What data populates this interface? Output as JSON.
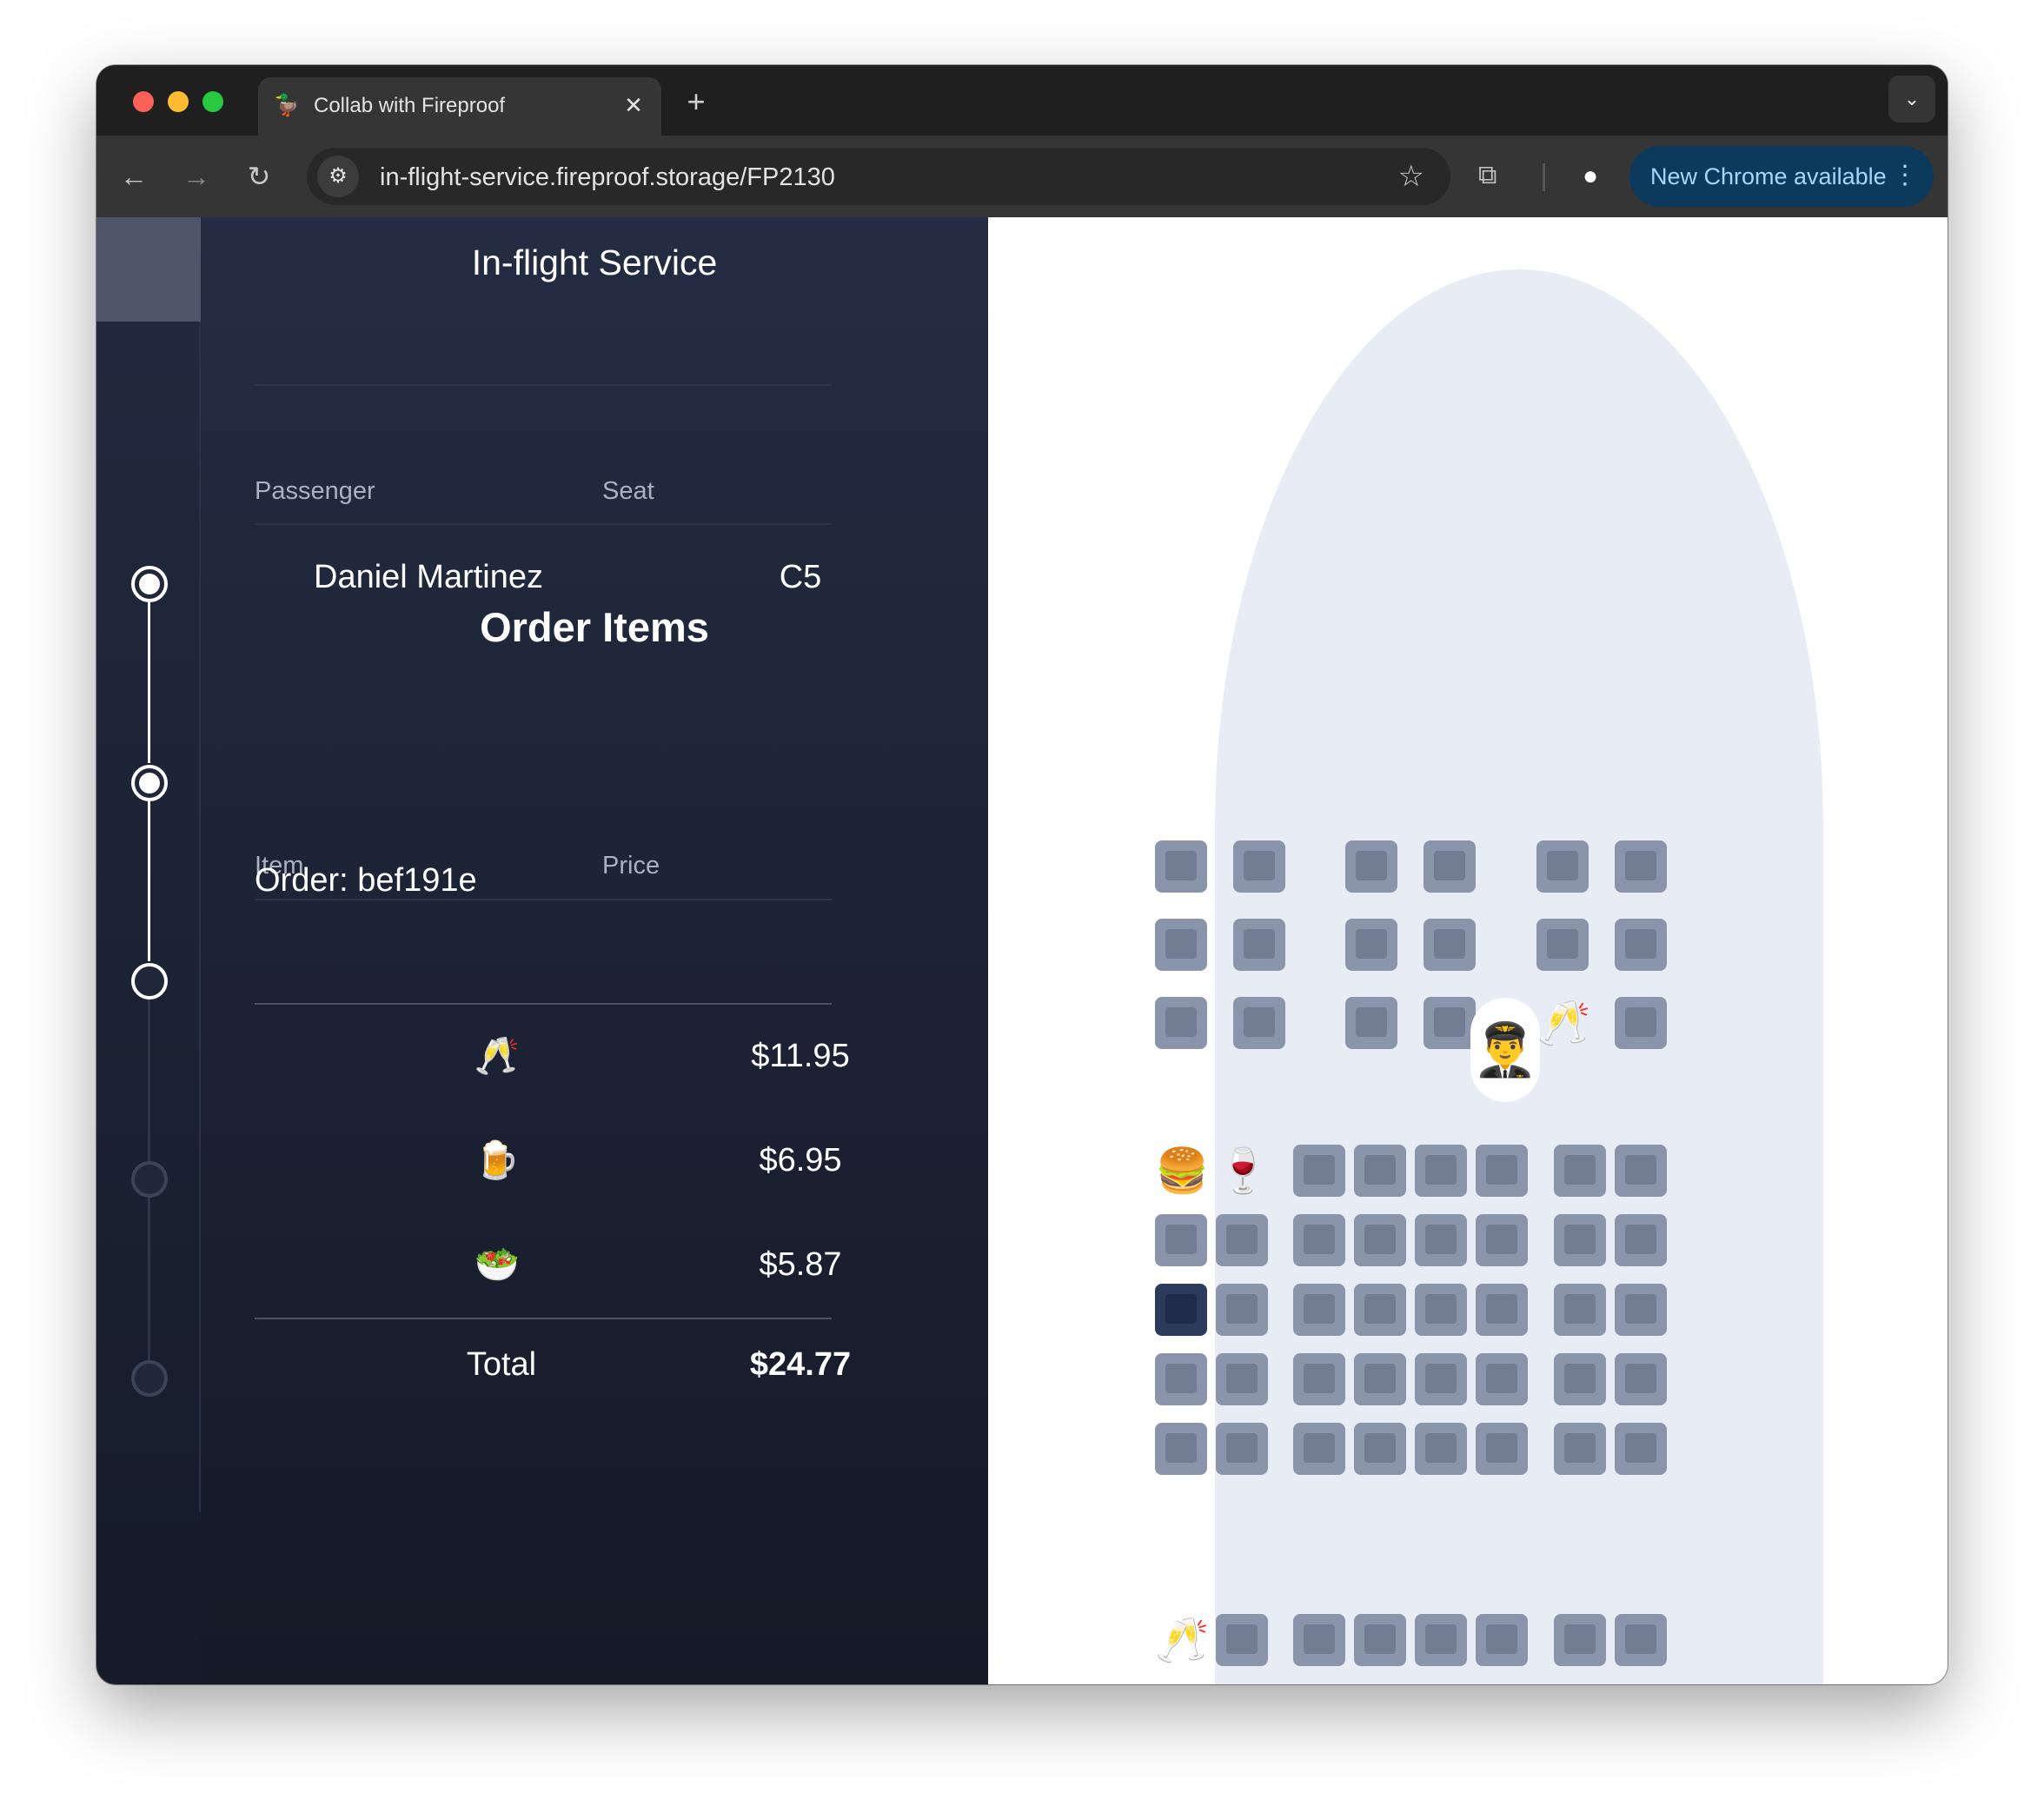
{
  "browser": {
    "tab_title": "Collab with Fireproof",
    "tab_favicon": "🦆",
    "tab_close": "✕",
    "new_tab": "+",
    "tab_search": "⌄",
    "url": "in-flight-service.fireproof.storage/FP2130",
    "back": "←",
    "forward": "→",
    "reload": "↻",
    "site_info": "⚙",
    "bookmark": "☆",
    "extensions": "⧉",
    "profile": "●",
    "update_label": "New Chrome available",
    "update_menu": "⋮"
  },
  "panel": {
    "title": "In-flight Service",
    "passenger_header": "Passenger",
    "seat_header": "Seat",
    "passenger_name": "Daniel Martinez",
    "seat": "C5",
    "order_title": "Order Items",
    "item_header": "Item",
    "price_header": "Price",
    "order_id": "Order: bef191e",
    "items": [
      {
        "emoji": "🥂",
        "name": "champagne",
        "price": "$11.95"
      },
      {
        "emoji": "🍺",
        "name": "beer",
        "price": "$6.95"
      },
      {
        "emoji": "🥗",
        "name": "salad",
        "price": "$5.87"
      }
    ],
    "total_label": "Total",
    "total_value": "$24.77"
  },
  "steps": [
    {
      "state": "done"
    },
    {
      "state": "done"
    },
    {
      "state": "current"
    },
    {
      "state": "pending"
    },
    {
      "state": "pending"
    }
  ],
  "seatmap": {
    "first_class": [
      [
        "",
        "",
        "",
        "",
        "",
        ""
      ],
      [
        "",
        "",
        "",
        "",
        "",
        ""
      ],
      [
        "",
        "",
        "",
        "",
        "🥂",
        ""
      ]
    ],
    "economy": [
      [
        "🍔",
        "🍷",
        "",
        "",
        "",
        "",
        "",
        ""
      ],
      [
        "",
        "",
        "",
        "",
        "",
        "",
        "",
        ""
      ],
      [
        "selected",
        "",
        "",
        "",
        "",
        "",
        "",
        ""
      ],
      [
        "",
        "",
        "",
        "",
        "",
        "",
        "",
        ""
      ],
      [
        "",
        "",
        "",
        "",
        "",
        "",
        "",
        ""
      ]
    ],
    "rear": [
      [
        "🥂",
        "",
        "",
        "",
        "",
        "",
        "",
        ""
      ]
    ],
    "attendant": "👨‍✈️"
  },
  "colors": {
    "panel_bg": "#1f2738",
    "seat": "#8a95ab",
    "seat_selected": "#2c3a5e",
    "fuselage": "#e8ecf4",
    "update_bg": "#0b3a5c"
  }
}
